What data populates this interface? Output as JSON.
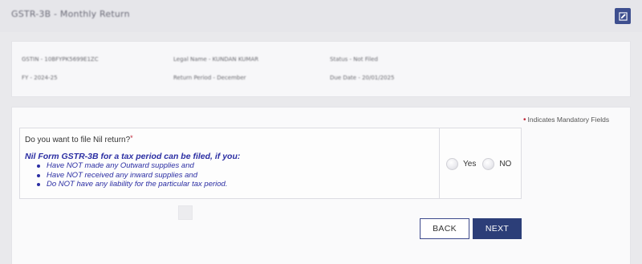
{
  "header": {
    "title": "GSTR-3B - Monthly Return",
    "action_icon": "edit-icon",
    "accent_color": "#3e4f8f"
  },
  "summary": {
    "gstin": "GSTIN - 10BFYPK5699E1ZC",
    "legal_name": "Legal Name - KUNDAN KUMAR",
    "status": "Status - Not Filed",
    "fy": "FY - 2024-25",
    "return_period": "Return Period - December",
    "due_date": "Due Date - 20/01/2025"
  },
  "form": {
    "mandatory_note": "Indicates Mandatory Fields",
    "question": "Do you want to file Nil return?",
    "nil_heading": "Nil Form GSTR-3B for a tax period can be filed, if you:",
    "conditions": [
      "Have NOT made any Outward supplies and",
      "Have NOT received any inward supplies and",
      "Do NOT have any liability for the particular tax period."
    ],
    "options": {
      "yes": "Yes",
      "no": "NO"
    },
    "selected_option": null
  },
  "actions": {
    "back": "BACK",
    "next": "NEXT"
  }
}
